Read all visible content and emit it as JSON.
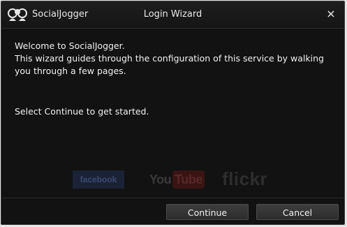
{
  "titlebar": {
    "app_name": "SocialJogger",
    "title": "Login Wizard",
    "close_glyph": "×"
  },
  "content": {
    "welcome": "Welcome to SocialJogger.",
    "description": "This wizard guides through the configuration of this service by walking you through a few pages.",
    "instruction": "Select Continue to get started."
  },
  "logos": {
    "facebook": "facebook",
    "youtube_you": "You",
    "youtube_tube": "Tube",
    "flickr": "flickr"
  },
  "buttons": {
    "continue": "Continue",
    "cancel": "Cancel"
  },
  "colors": {
    "window_bg": "#121212",
    "text": "#f0f0f0"
  }
}
